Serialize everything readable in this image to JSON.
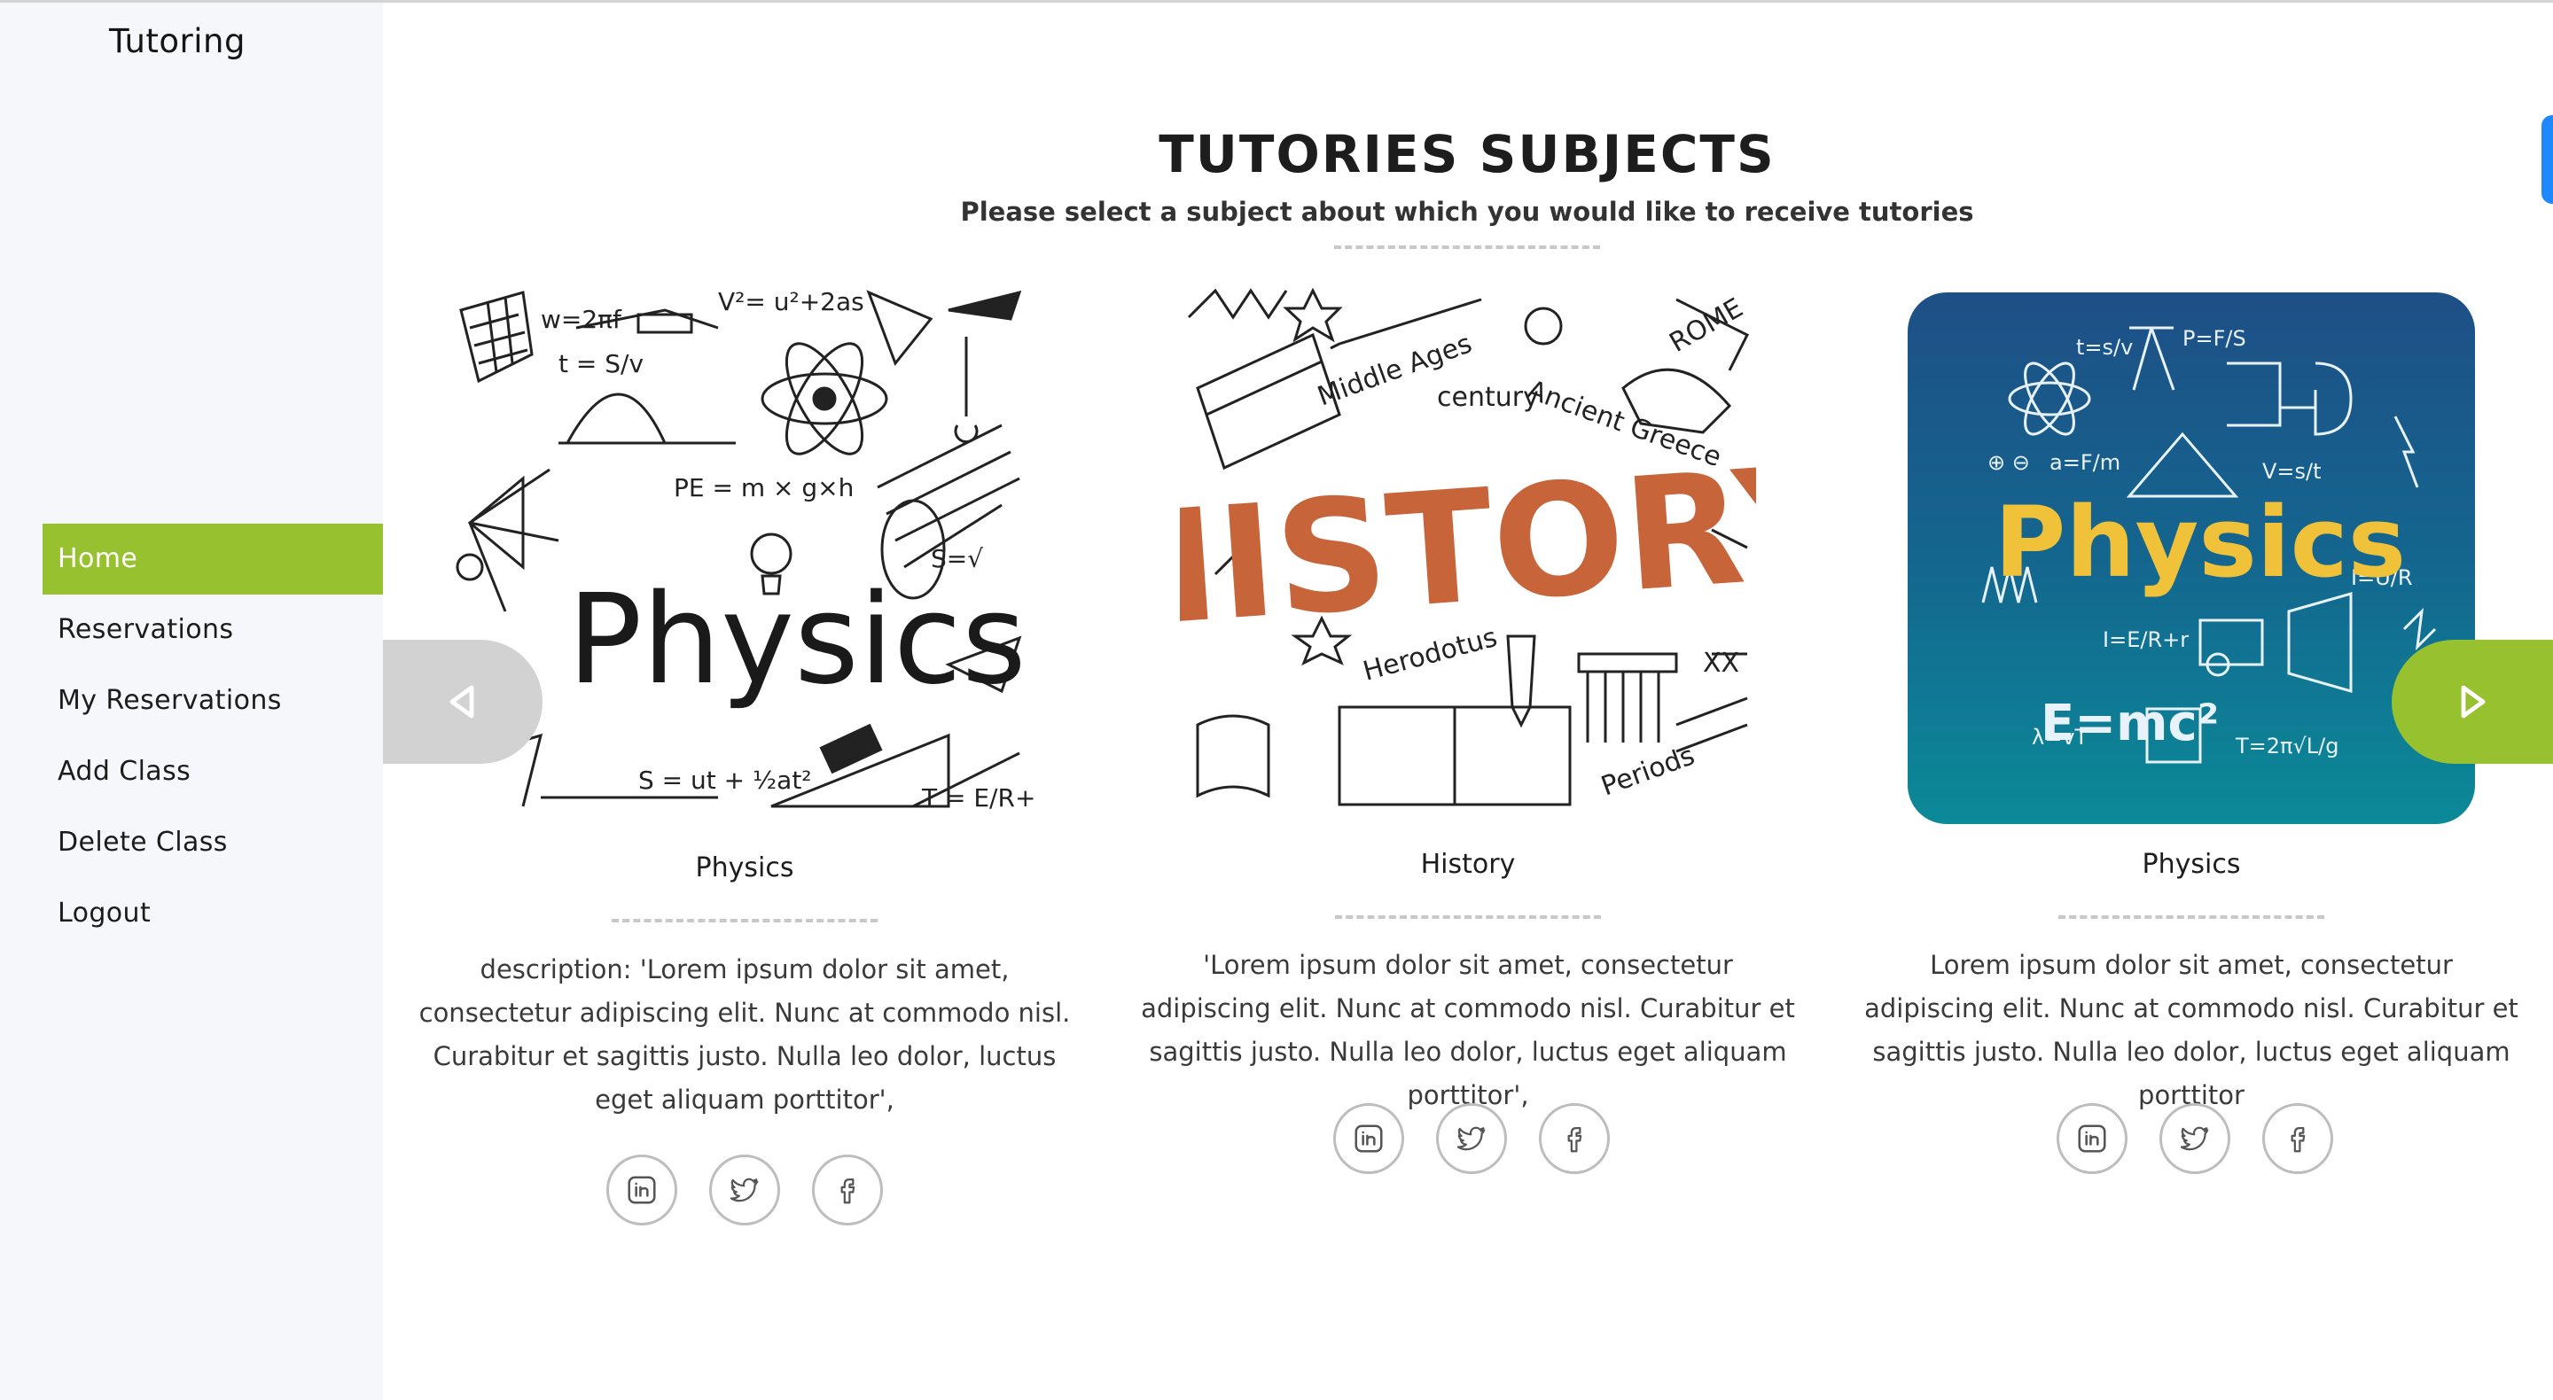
{
  "app": {
    "brand": "Tutoring"
  },
  "sidebar": {
    "items": [
      {
        "label": "Home",
        "active": true
      },
      {
        "label": "Reservations",
        "active": false
      },
      {
        "label": "My Reservations",
        "active": false
      },
      {
        "label": "Add Class",
        "active": false
      },
      {
        "label": "Delete Class",
        "active": false
      },
      {
        "label": "Logout",
        "active": false
      }
    ]
  },
  "header": {
    "title": "TUTORIES SUBJECTS",
    "subtitle": "Please select a subject about which you would like to receive tutories"
  },
  "cards": [
    {
      "name": "Physics",
      "image_text": "Physics",
      "description": "description: 'Lorem ipsum dolor sit amet, consectetur adipiscing elit. Nunc at commodo nisl. Curabitur et sagittis justo. Nulla leo dolor, luctus eget aliquam porttitor',"
    },
    {
      "name": "History",
      "image_text": "HISTORY",
      "description": "'Lorem ipsum dolor sit amet, consectetur adipiscing elit. Nunc at commodo nisl. Curabitur et sagittis justo. Nulla leo dolor, luctus eget aliquam porttitor',"
    },
    {
      "name": "Physics",
      "image_text": "Physics",
      "description": "Lorem ipsum dolor sit amet, consectetur adipiscing elit. Nunc at commodo nisl. Curabitur et sagittis justo. Nulla leo dolor, luctus eget aliquam porttitor"
    }
  ],
  "social_icons": [
    "linkedin-icon",
    "twitter-icon",
    "facebook-icon"
  ],
  "carousel": {
    "prev_icon": "triangle-left-icon",
    "next_icon": "triangle-right-icon"
  },
  "colors": {
    "accent": "#97c12f",
    "sidebar_bg": "#f6f7fa",
    "prev_arrow_bg": "#d2d2d2",
    "history_orange": "#c8643a",
    "physics_card_top": "#1e4f86",
    "physics_card_bottom": "#0b8a98",
    "physics_card_text": "#f0c23a",
    "edge_tab": "#1e88ff"
  }
}
